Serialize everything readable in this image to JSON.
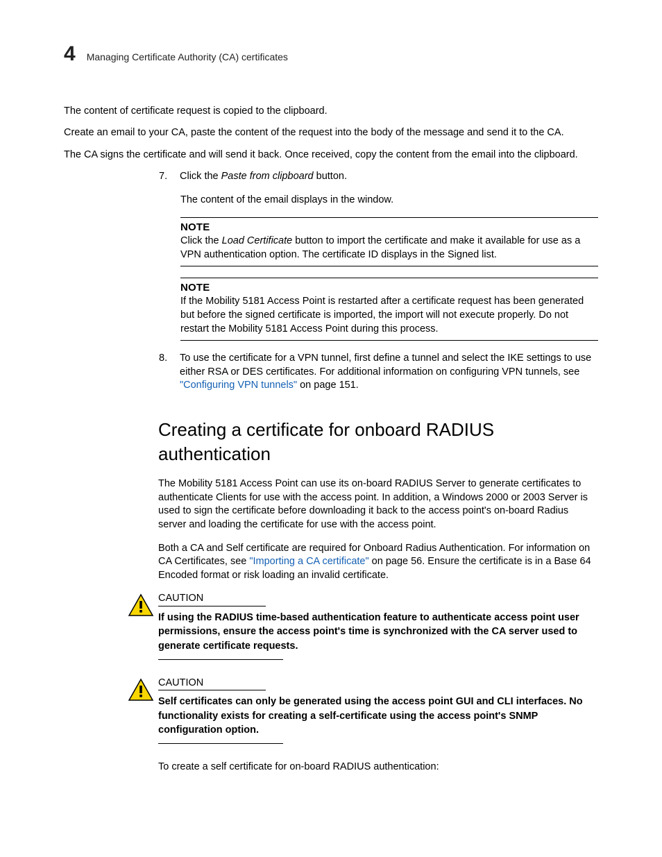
{
  "header": {
    "chapter_number": "4",
    "chapter_title": "Managing Certificate Authority (CA) certificates"
  },
  "body": {
    "p1": "The content of certificate request is copied to the clipboard.",
    "p2": "Create an email to your CA, paste the content of the request into the body of the message and send it to the CA.",
    "p3": "The CA signs the certificate and will send it back. Once received, copy the content from the email into the clipboard.",
    "step7_num": "7.",
    "step7_a": "Click the ",
    "step7_i": "Paste from clipboard",
    "step7_b": " button.",
    "step7_sub": "The content of the email displays in the window.",
    "note1_label": "NOTE",
    "note1_a": "Click the ",
    "note1_i": "Load Certificate",
    "note1_b": " button to import the certificate and make it available for use as a VPN authentication option. The certificate ID displays in the Signed list.",
    "note2_label": "NOTE",
    "note2_text": "If the Mobility 5181 Access Point is restarted after a certificate request has been generated but before the signed certificate is imported, the import will not execute properly. Do not restart the Mobility 5181 Access Point during this process.",
    "step8_num": "8.",
    "step8_a": "To use the certificate for a VPN tunnel, first define a tunnel and select the IKE settings to use either RSA or DES certificates. For additional information on configuring VPN tunnels, see ",
    "step8_link": "\"Configuring VPN tunnels\"",
    "step8_b": " on page 151.",
    "h2": "Creating a certificate for onboard RADIUS authentication",
    "intro1": "The Mobility 5181 Access Point can use its on-board RADIUS Server to generate certificates to authenticate Clients for use with the access point. In addition, a Windows 2000 or 2003 Server is used to sign the certificate before downloading it back to the access point's on-board Radius server and loading the certificate for use with the access point.",
    "intro2_a": "Both a CA and Self certificate are required for Onboard Radius Authentication. For information on CA Certificates, see ",
    "intro2_link": "\"Importing a CA certificate\"",
    "intro2_b": " on page 56. Ensure the certificate is in a Base 64 Encoded format or risk loading an invalid certificate.",
    "caution1_label": "CAUTION",
    "caution1_text": "If using the RADIUS time-based authentication feature to authenticate access point user permissions, ensure the access point's time is synchronized with the CA server used to generate certificate requests.",
    "caution2_label": "CAUTION",
    "caution2_text": "Self certificates can only be generated using the access point GUI and CLI interfaces. No functionality exists for creating a self-certificate using the access point's SNMP configuration option.",
    "outro": "To create a self certificate for on-board RADIUS authentication:"
  }
}
